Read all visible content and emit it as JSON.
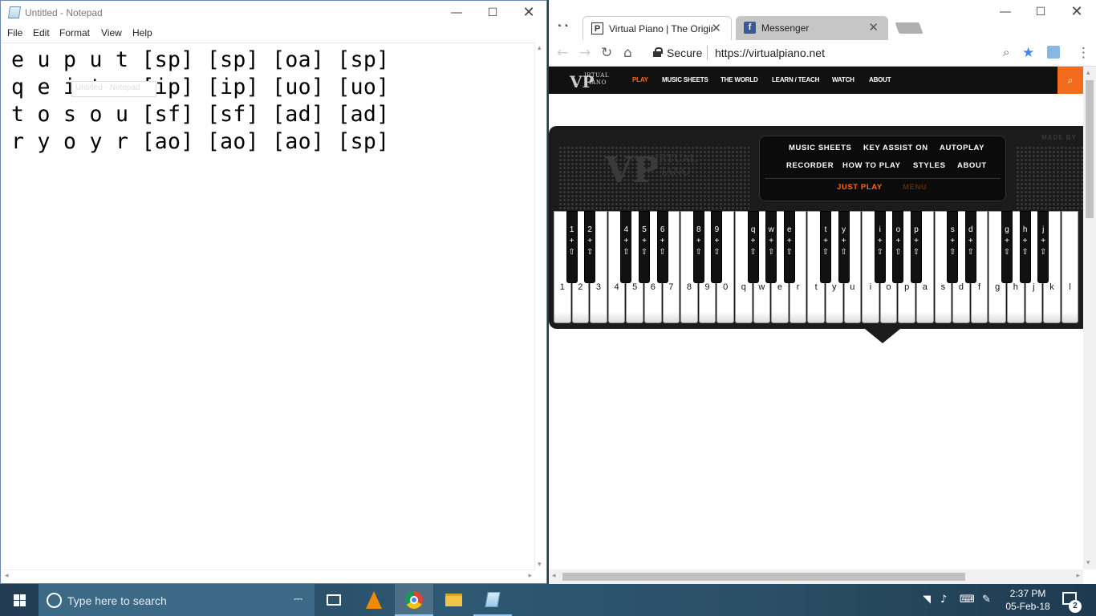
{
  "notepad": {
    "title": "Untitled - Notepad",
    "menu": [
      "File",
      "Edit",
      "Format",
      "View",
      "Help"
    ],
    "lines": [
      "e u p u t [sp] [sp] [oa] [sp]",
      "q e i t e [ip] [ip] [uo] [uo]",
      "t o s o u [sf] [sf] [ad] [ad]",
      "r y o y r [ao] [ao] [ao] [sp]"
    ],
    "tooltip": "Untitled - Notepad"
  },
  "chrome": {
    "tabs": [
      {
        "label": "Virtual Piano | The Origin",
        "favicon": "P",
        "active": true
      },
      {
        "label": "Messenger",
        "favicon": "f",
        "active": false
      }
    ],
    "secure_label": "Secure",
    "url": "https://virtualpiano.net"
  },
  "site": {
    "logo_top": "IRTUAL",
    "logo_bottom": "IANO",
    "logo_mark": "VP",
    "nav": [
      "PLAY",
      "MUSIC SHEETS",
      "THE WORLD",
      "LEARN / TEACH",
      "WATCH",
      "ABOUT"
    ],
    "active_nav": "PLAY",
    "made_by": "MADE BY",
    "menu_row1": [
      "MUSIC SHEETS",
      "KEY ASSIST ON",
      "AUTOPLAY"
    ],
    "menu_row2": [
      "RECORDER",
      "HOW TO PLAY",
      "STYLES",
      "ABOUT"
    ],
    "just_play": "JUST PLAY",
    "menu": "MENU",
    "white_keys": [
      "1",
      "2",
      "3",
      "4",
      "5",
      "6",
      "7",
      "8",
      "9",
      "0",
      "q",
      "w",
      "e",
      "r",
      "t",
      "y",
      "u",
      "i",
      "o",
      "p",
      "a",
      "s",
      "d",
      "f",
      "g",
      "h",
      "j",
      "k",
      "l"
    ],
    "black_keys": [
      "1",
      "2",
      "4",
      "5",
      "6",
      "8",
      "9",
      "q",
      "w",
      "e",
      "t",
      "y",
      "i",
      "o",
      "p",
      "s",
      "d",
      "g",
      "h",
      "j"
    ]
  },
  "taskbar": {
    "search_placeholder": "Type here to search",
    "time": "2:37 PM",
    "date": "05-Feb-18",
    "notification_count": "2"
  },
  "colors": {
    "accent_orange": "#ff6a13",
    "taskbar": "#2e5873"
  }
}
